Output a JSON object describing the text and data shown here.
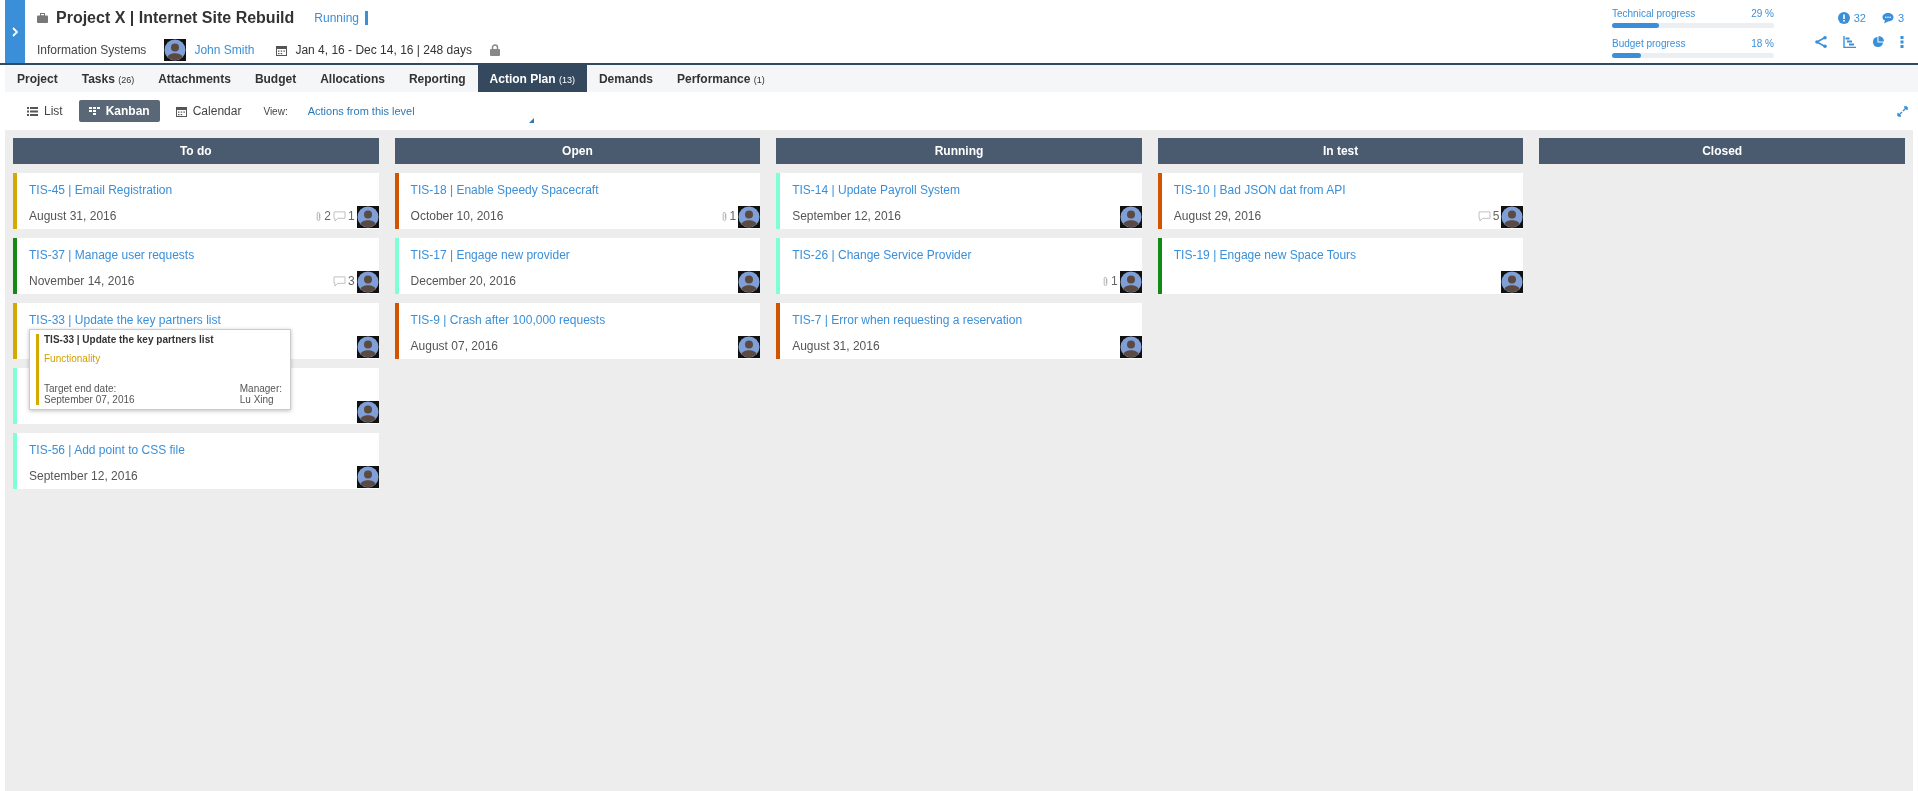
{
  "project": {
    "title": "Project X | Internet Site Rebuild",
    "status": "Running",
    "department": "Information Systems",
    "manager": "John Smith",
    "dates": "Jan 4, 16 - Dec 14, 16 | 248 days"
  },
  "progress": [
    {
      "label": "Technical progress",
      "reading": "29 %",
      "level": 0.29
    },
    {
      "label": "Budget progress",
      "reading": "18 %",
      "level": 0.18
    }
  ],
  "counters": [
    {
      "kind": "alert",
      "count": "32"
    },
    {
      "kind": "comment",
      "count": "3"
    }
  ],
  "tabs": [
    {
      "label": "Project",
      "selected": false
    },
    {
      "label": "Tasks",
      "count": "(26)",
      "selected": false
    },
    {
      "label": "Attachments",
      "selected": false
    },
    {
      "label": "Budget",
      "selected": false
    },
    {
      "label": "Allocations",
      "selected": false
    },
    {
      "label": "Reporting",
      "selected": false
    },
    {
      "label": "Action Plan",
      "count": "(13)",
      "selected": true
    },
    {
      "label": "Demands",
      "selected": false
    },
    {
      "label": "Performance",
      "count": "(1)",
      "selected": false
    }
  ],
  "view_modes": [
    {
      "kind": "list",
      "label": "List",
      "selected": false
    },
    {
      "kind": "kanban",
      "label": "Kanban",
      "selected": true
    },
    {
      "kind": "calendar",
      "label": "Calendar",
      "selected": false
    }
  ],
  "view_filter": {
    "label": "View:",
    "value": "Actions from this level"
  },
  "columns": [
    {
      "title": "To do",
      "cards": [
        {
          "title": "TIS-45 | Email Registration",
          "date": "August 31, 2016",
          "color": "#d4a900",
          "attachments": "2",
          "comments": "1"
        },
        {
          "title": "TIS-37 | Manage user requests",
          "date": "November 14, 2016",
          "color": "#138a13",
          "comments": "3"
        },
        {
          "title": "TIS-33 | Update the key partners list",
          "color": "#d4a900",
          "tooltip": {
            "title": "TIS-33 | Update the key partners list",
            "category": "Functionality",
            "date_label": "Target end date:",
            "date": "September 07, 2016",
            "manager_label": "Manager:",
            "manager": "Lu Xing"
          }
        },
        {
          "color": "#7fffd4"
        },
        {
          "title": "TIS-56 | Add point to CSS file",
          "date": "September 12, 2016",
          "color": "#7fffd4"
        }
      ]
    },
    {
      "title": "Open",
      "cards": [
        {
          "title": "TIS-18 | Enable Speedy Spacecraft",
          "date": "October 10, 2016",
          "color": "#d35400",
          "attachments": "1"
        },
        {
          "title": "TIS-17 | Engage new provider",
          "date": "December 20, 2016",
          "color": "#7fffd4"
        },
        {
          "title": "TIS-9 | Crash after 100,000 requests",
          "date": "August 07, 2016",
          "color": "#d35400"
        }
      ]
    },
    {
      "title": "Running",
      "cards": [
        {
          "title": "TIS-14 | Update Payroll System",
          "date": "September 12, 2016",
          "color": "#7fffd4"
        },
        {
          "title": "TIS-26 | Change Service Provider",
          "color": "#7fffd4",
          "attachments": "1"
        },
        {
          "title": "TIS-7 | Error when requesting a reservation",
          "date": "August 31, 2016",
          "color": "#d35400"
        }
      ]
    },
    {
      "title": "In test",
      "cards": [
        {
          "title": "TIS-10 | Bad JSON dat from API",
          "date": "August 29, 2016",
          "color": "#d35400",
          "comments": "5"
        },
        {
          "title": "TIS-19 | Engage new Space Tours",
          "color": "#138a13"
        }
      ]
    },
    {
      "title": "Closed"
    }
  ]
}
